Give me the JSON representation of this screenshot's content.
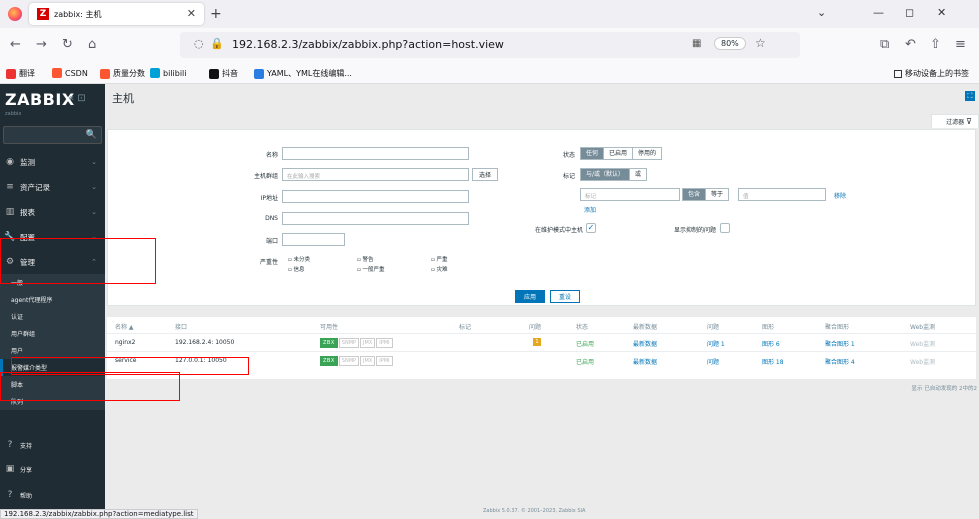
{
  "browser": {
    "tab_title": "zabbix: 主机",
    "url": "192.168.2.3/zabbix/zabbix.php?action=host.view",
    "zoom": "80%",
    "status_url": "192.168.2.3/zabbix/zabbix.php?action=mediatype.list",
    "bookmarks": [
      "翻译",
      "CSDN",
      "质量分数",
      "bilibili",
      "抖音",
      "YAML、YML在线编辑..."
    ],
    "mobile_bookmarks": "移动设备上的书签"
  },
  "sidebar": {
    "logo": "ZABBIX",
    "server": "zabbix",
    "menu": [
      {
        "label": "监测"
      },
      {
        "label": "资产记录"
      },
      {
        "label": "报表"
      },
      {
        "label": "配置"
      },
      {
        "label": "管理"
      }
    ],
    "submenu": [
      "一般",
      "agent代理程序",
      "认证",
      "用户群组",
      "用户",
      "报警媒介类型",
      "脚本",
      "队列"
    ],
    "bottom": [
      "支持",
      "分享",
      "帮助"
    ]
  },
  "page": {
    "title": "主机",
    "filter_tab": "过滤器",
    "filter": {
      "name_label": "名称",
      "hostgroup_label": "主机群组",
      "hostgroup_placeholder": "在此输入搜索",
      "select_btn": "选择",
      "ip_label": "IP地址",
      "dns_label": "DNS",
      "port_label": "端口",
      "severity_label": "严重性",
      "severities": [
        "未分类",
        "信息",
        "警告",
        "一般严重",
        "严重",
        "灾难"
      ],
      "status_label": "状态",
      "status_options": [
        "任何",
        "已启用",
        "停用的"
      ],
      "tags_label": "标记",
      "tag_options": [
        "与/或（默认）",
        "或"
      ],
      "tag_placeholder": "标记",
      "tag_ops": [
        "包含",
        "等于"
      ],
      "value_placeholder": "值",
      "remove": "移除",
      "add": "添加",
      "maint_label": "在维护模式中主机",
      "suppressed_label": "显示抑制的问题",
      "apply": "应用",
      "reset": "重设"
    },
    "table": {
      "headers": [
        "名称 ▲",
        "接口",
        "可用性",
        "标记",
        "问题",
        "状态",
        "最新数据",
        "问题",
        "图形",
        "聚合图形",
        "Web监测"
      ],
      "rows": [
        {
          "name": "nginx2",
          "iface": "192.168.2.4: 10050",
          "problems": "1",
          "status": "已启用",
          "latest": "最新数据",
          "prob": "问题 1",
          "graphs": "图形 6",
          "screens": "聚合图形 1",
          "web": "Web监测"
        },
        {
          "name": "service",
          "iface": "127.0.0.1: 10050",
          "problems": "",
          "status": "已启用",
          "latest": "最新数据",
          "prob": "问题",
          "graphs": "图形 18",
          "screens": "聚合图形 4",
          "web": "Web监测"
        }
      ],
      "avail": [
        "ZBX",
        "SNMP",
        "JMX",
        "IPMI"
      ],
      "footer": "显示 已自动发现的 2中的2"
    },
    "copyright": "Zabbix 5.0.37. © 2001–2023, Zabbix SIA"
  }
}
